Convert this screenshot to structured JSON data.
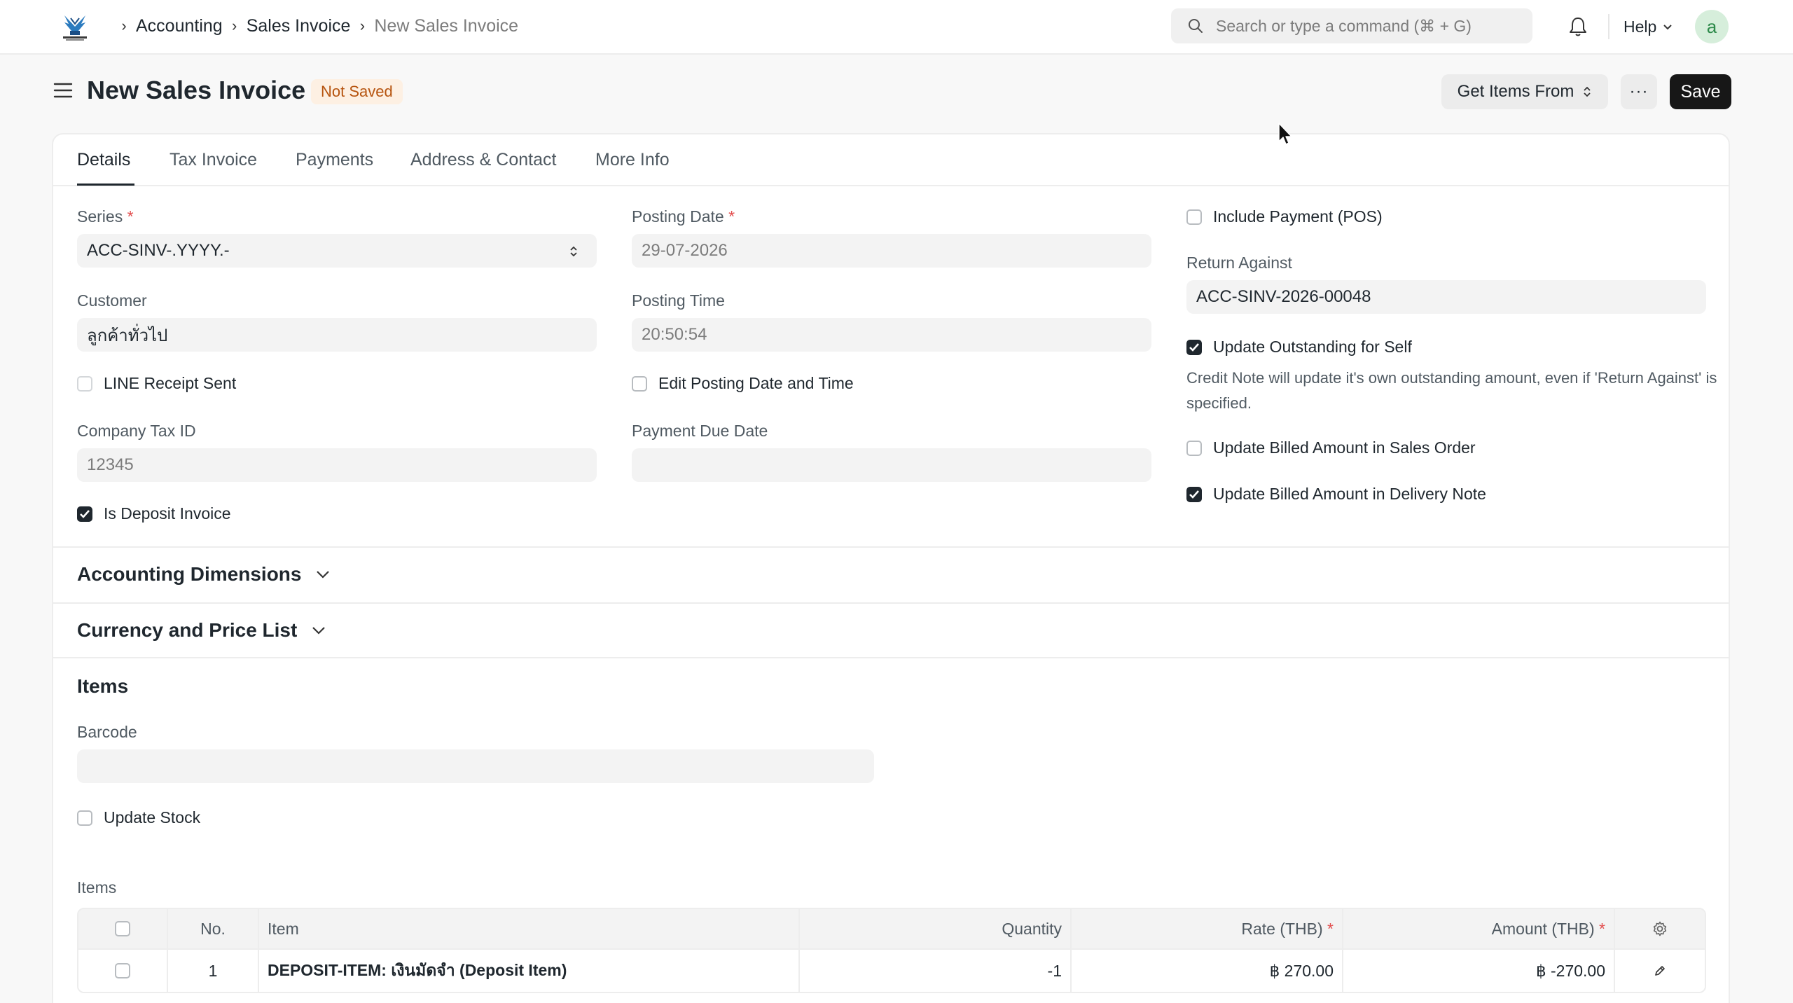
{
  "navbar": {
    "breadcrumbs": [
      "Accounting",
      "Sales Invoice",
      "New Sales Invoice"
    ],
    "search_placeholder": "Search or type a command (⌘ + G)",
    "help_label": "Help",
    "avatar_initial": "a"
  },
  "page": {
    "title": "New Sales Invoice",
    "status": "Not Saved",
    "get_items_label": "Get Items From",
    "more_label": "···",
    "save_label": "Save"
  },
  "tabs": [
    "Details",
    "Tax Invoice",
    "Payments",
    "Address & Contact",
    "More Info"
  ],
  "form": {
    "series_label": "Series",
    "series_value": "ACC-SINV-.YYYY.-",
    "customer_label": "Customer",
    "customer_value": "ลูกค้าทั่วไป",
    "line_receipt_label": "LINE Receipt Sent",
    "company_tax_label": "Company Tax ID",
    "company_tax_value": "12345",
    "is_deposit_label": "Is Deposit Invoice",
    "posting_date_label": "Posting Date",
    "posting_date_value": "29-07-2026",
    "posting_time_label": "Posting Time",
    "posting_time_value": "20:50:54",
    "edit_posting_label": "Edit Posting Date and Time",
    "payment_due_label": "Payment Due Date",
    "payment_due_value": "",
    "include_payment_label": "Include Payment (POS)",
    "return_against_label": "Return Against",
    "return_against_value": "ACC-SINV-2026-00048",
    "update_outstanding_label": "Update Outstanding for Self",
    "update_outstanding_desc": "Credit Note will update it's own outstanding amount, even if 'Return Against' is specified.",
    "update_billed_so_label": "Update Billed Amount in Sales Order",
    "update_billed_dn_label": "Update Billed Amount in Delivery Note"
  },
  "sections": {
    "accounting_dimensions": "Accounting Dimensions",
    "currency_price_list": "Currency and Price List",
    "items": "Items",
    "barcode_label": "Barcode",
    "update_stock_label": "Update Stock",
    "items_table_label": "Items"
  },
  "items_table": {
    "headers": [
      "No.",
      "Item",
      "Quantity",
      "Rate (THB)",
      "Amount (THB)"
    ],
    "rows": [
      {
        "no": "1",
        "item": "DEPOSIT-ITEM: เงินมัดจำ (Deposit Item)",
        "qty": "-1",
        "rate": "฿ 270.00",
        "amount": "฿ -270.00"
      }
    ]
  }
}
